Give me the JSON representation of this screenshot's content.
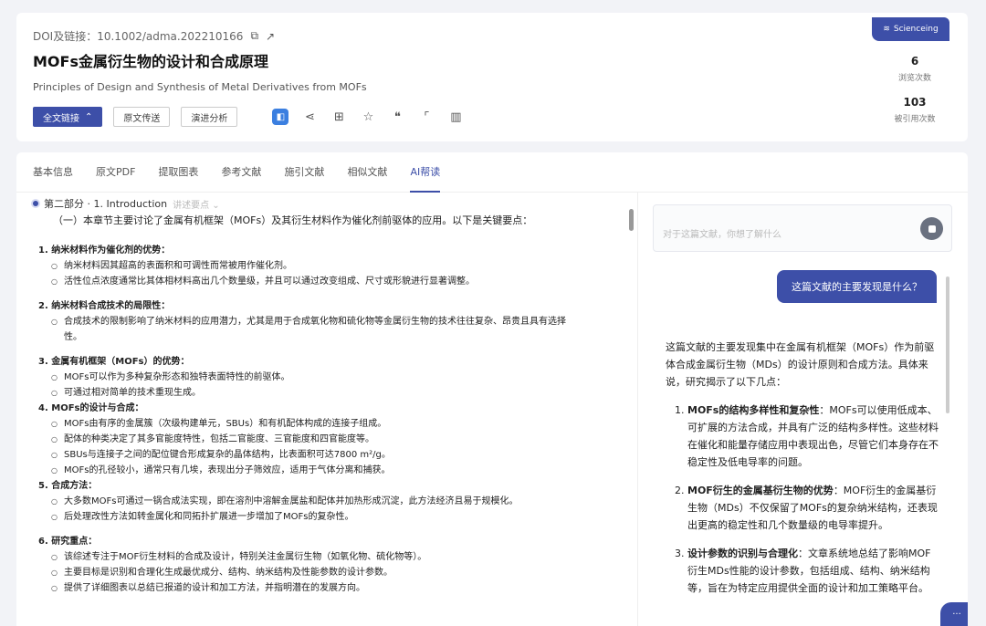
{
  "header": {
    "doi": "DOI及链接：10.1002/adma.202210166",
    "title": "MOFs金属衍生物的设计和合成原理",
    "subtitle": "Principles of Design and Synthesis of Metal Derivatives from MOFs",
    "badge": "Scienceing"
  },
  "actions": {
    "fulltext": "全文链接",
    "original": "原文传送",
    "analysis": "演进分析"
  },
  "stats": [
    {
      "value": "6",
      "label": "浏览次数"
    },
    {
      "value": "103",
      "label": "被引用次数"
    }
  ],
  "tabs": [
    "基本信息",
    "原文PDF",
    "提取图表",
    "参考文献",
    "施引文献",
    "相似文献",
    "AI帮读"
  ],
  "left": {
    "section": "第二部分 · 1. Introduction",
    "section_hint": "讲述要点",
    "intro": "（一）本章节主要讨论了金属有机框架（MOFs）及其衍生材料作为催化剂前驱体的应用。以下是关键要点：",
    "groups": [
      {
        "title": "1. 纳米材料作为催化剂的优势：",
        "bullets": [
          "纳米材料因其超高的表面积和可调性而常被用作催化剂。",
          "活性位点浓度通常比其体相材料高出几个数量级，并且可以通过改变组成、尺寸或形貌进行显著调整。"
        ]
      },
      {
        "title": "2. 纳米材料合成技术的局限性：",
        "bullets": [
          "合成技术的限制影响了纳米材料的应用潜力，尤其是用于合成氧化物和硫化物等金属衍生物的技术往往复杂、昂贵且具有选择",
          "性。"
        ]
      },
      {
        "title": "3. 金属有机框架（MOFs）的优势：",
        "bullets": [
          "MOFs可以作为多种复杂形态和独特表面特性的前驱体。",
          "可通过相对简单的技术重现生成。"
        ]
      },
      {
        "title": "4. MOFs的设计与合成：",
        "bullets": [
          "MOFs由有序的金属簇（次级构建单元，SBUs）和有机配体构成的连接子组成。",
          "配体的种类决定了其多官能度特性，包括二官能度、三官能度和四官能度等。",
          "SBUs与连接子之间的配位键合形成复杂的晶体结构，比表面积可达7800 m²/g。",
          "MOFs的孔径较小，通常只有几埃，表现出分子筛效应，适用于气体分离和捕获。"
        ]
      },
      {
        "title": "5. 合成方法：",
        "bullets": [
          "大多数MOFs可通过一锅合成法实现，即在溶剂中溶解金属盐和配体并加热形成沉淀，此方法经济且易于规模化。",
          "后处理改性方法如转金属化和同拓扑扩展进一步增加了MOFs的复杂性。"
        ]
      },
      {
        "title": "6. 研究重点：",
        "bullets": [
          "该综述专注于MOF衍生材料的合成及设计，特别关注金属衍生物（如氧化物、硫化物等）。",
          "主要目标是识别和合理化生成最优成分、结构、纳米结构及性能参数的设计参数。",
          "提供了详细图表以总结已报道的设计和加工方法，并指明潜在的发展方向。"
        ]
      }
    ]
  },
  "right": {
    "ask_placeholder": "对于这篇文献，你想了解什么",
    "question": "这篇文献的主要发现是什么？",
    "answer_intro": "这篇文献的主要发现集中在金属有机框架（MOFs）作为前驱体合成金属衍生物（MDs）的设计原则和合成方法。具体来说，研究揭示了以下几点：",
    "answer_items": [
      {
        "num": "1.",
        "title": "MOFs的结构多样性和复杂性",
        "text": "：MOFs可以使用低成本、可扩展的方法合成，并具有广泛的结构多样性。这些材料在催化和能量存储应用中表现出色，尽管它们本身存在不稳定性及低电导率的问题。"
      },
      {
        "num": "2.",
        "title": "MOF衍生的金属基衍生物的优势",
        "text": "：MOF衍生的金属基衍生物（MDs）不仅保留了MOFs的复杂纳米结构，还表现出更高的稳定性和几个数量级的电导率提升。"
      },
      {
        "num": "3.",
        "title": "设计参数的识别与合理化",
        "text": "：文章系统地总结了影响MOF衍生MDs性能的设计参数，包括组成、结构、纳米结构等，旨在为特定应用提供全面的设计和加工策略平台。"
      }
    ]
  }
}
